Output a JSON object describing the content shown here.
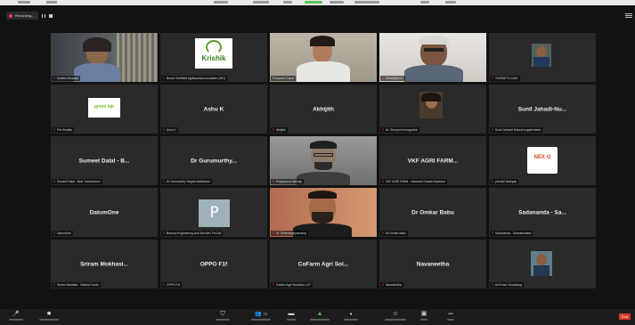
{
  "recording": {
    "label": "Recording..."
  },
  "tiles": [
    {
      "name": "tile-kavitha",
      "label": "Kavitha Dhavala",
      "video": "woman-headscarf",
      "muted": true
    },
    {
      "name": "tile-krishik",
      "label": "Bench Sheffield Agribusiness Incubator (SKI)",
      "video": "krishik-logo",
      "logo_text": "Krishik",
      "muted": true
    },
    {
      "name": "tile-host",
      "label": "Prasanna Gopal",
      "video": "woman-center",
      "muted": false,
      "active": true
    },
    {
      "name": "tile-older-man",
      "label": "Chiranjeevi V",
      "video": "older-man",
      "muted": true
    },
    {
      "name": "tile-tharasiva",
      "label": "THARATTU KAVI",
      "video": "small-portrait",
      "muted": true
    },
    {
      "name": "tile-green-lab",
      "label": "Prit Khadka",
      "video": "green-lab-logo",
      "logo_text": "green lab",
      "muted": true
    },
    {
      "name": "tile-ashu",
      "label": "Ashu K",
      "center": "Ashu K",
      "muted": true
    },
    {
      "name": "tile-akhijith",
      "label": "Akhijith",
      "center": "Akhijith",
      "muted": true
    },
    {
      "name": "tile-shreya",
      "label": "Dr. Shreya Iorenagunike",
      "video": "small-portrait-2",
      "muted": true
    },
    {
      "name": "tile-sunil",
      "label": "Sunil Jahnadi Natural supplements",
      "center": "Sunil Jahadi-Nu...",
      "muted": true
    },
    {
      "name": "tile-sumeet",
      "label": "Sumeet Dalal - Biotr Transmotion",
      "center": "Sumeet Dalal - B...",
      "muted": true
    },
    {
      "name": "tile-gurumurthy",
      "label": "Dr Gurumurthy Hegde Aditshbach",
      "center": "Dr Gurumurthy...",
      "muted": true
    },
    {
      "name": "tile-pradyumna",
      "label": "Pradyumna Akkiraju",
      "video": "man-glasses",
      "muted": true
    },
    {
      "name": "tile-vkf",
      "label": "VKF AGRI FARM - Haveane Gowda Haveane",
      "center": "VKF AGRI FARM...",
      "muted": true
    },
    {
      "name": "tile-nexg",
      "label": "premsri kashyap",
      "video": "nexg-logo",
      "logo_text": "NEX-G",
      "muted": true
    },
    {
      "name": "tile-datumone",
      "label": "DatumOne",
      "center": "DatumOne",
      "muted": true
    },
    {
      "name": "tile-p-logo",
      "label": "Bravory Engineering and Services Pvt Ltd",
      "video": "p-logo",
      "logo_text": "P",
      "muted": true
    },
    {
      "name": "tile-bearded-man",
      "label": "Dr. Dharnanjayaswamy",
      "video": "bearded-man",
      "muted": true
    },
    {
      "name": "tile-omkar",
      "label": "Dr Omkar Babu",
      "center": "Dr Omkar Babu",
      "muted": true
    },
    {
      "name": "tile-sadananda",
      "label": "Sadananda - Samrakshana",
      "center": "Sadananda - Sa...",
      "muted": true
    },
    {
      "name": "tile-sriram",
      "label": "Sriram Mokhasi - Vriksha Foods",
      "center": "Sriram Mokhasi...",
      "muted": true
    },
    {
      "name": "tile-oppo",
      "label": "OPPO F1f",
      "center": "OPPO F1f",
      "muted": true
    },
    {
      "name": "tile-cofarm",
      "label": "Cofarm Agri Solutions LLP",
      "center": "CoFarm Agri Sol...",
      "muted": true
    },
    {
      "name": "tile-navaneetha",
      "label": "Navaneetha",
      "center": "Navaneetha",
      "muted": true
    },
    {
      "name": "tile-anil",
      "label": "Anil Kaur Vinaraiung",
      "video": "small-portrait-3",
      "muted": true
    }
  ],
  "toolbar": {
    "mute_glyph": "🎤",
    "video_glyph": "■",
    "security_glyph": "⛉",
    "participants_glyph": "👥",
    "participants_count": "73",
    "chat_glyph": "▬",
    "share_glyph": "▲",
    "record_glyph": "●",
    "reactions_glyph": "☺",
    "apps_glyph": "▣",
    "whiteboard_glyph": "▭",
    "more_glyph": "•••",
    "end_label": "End"
  }
}
